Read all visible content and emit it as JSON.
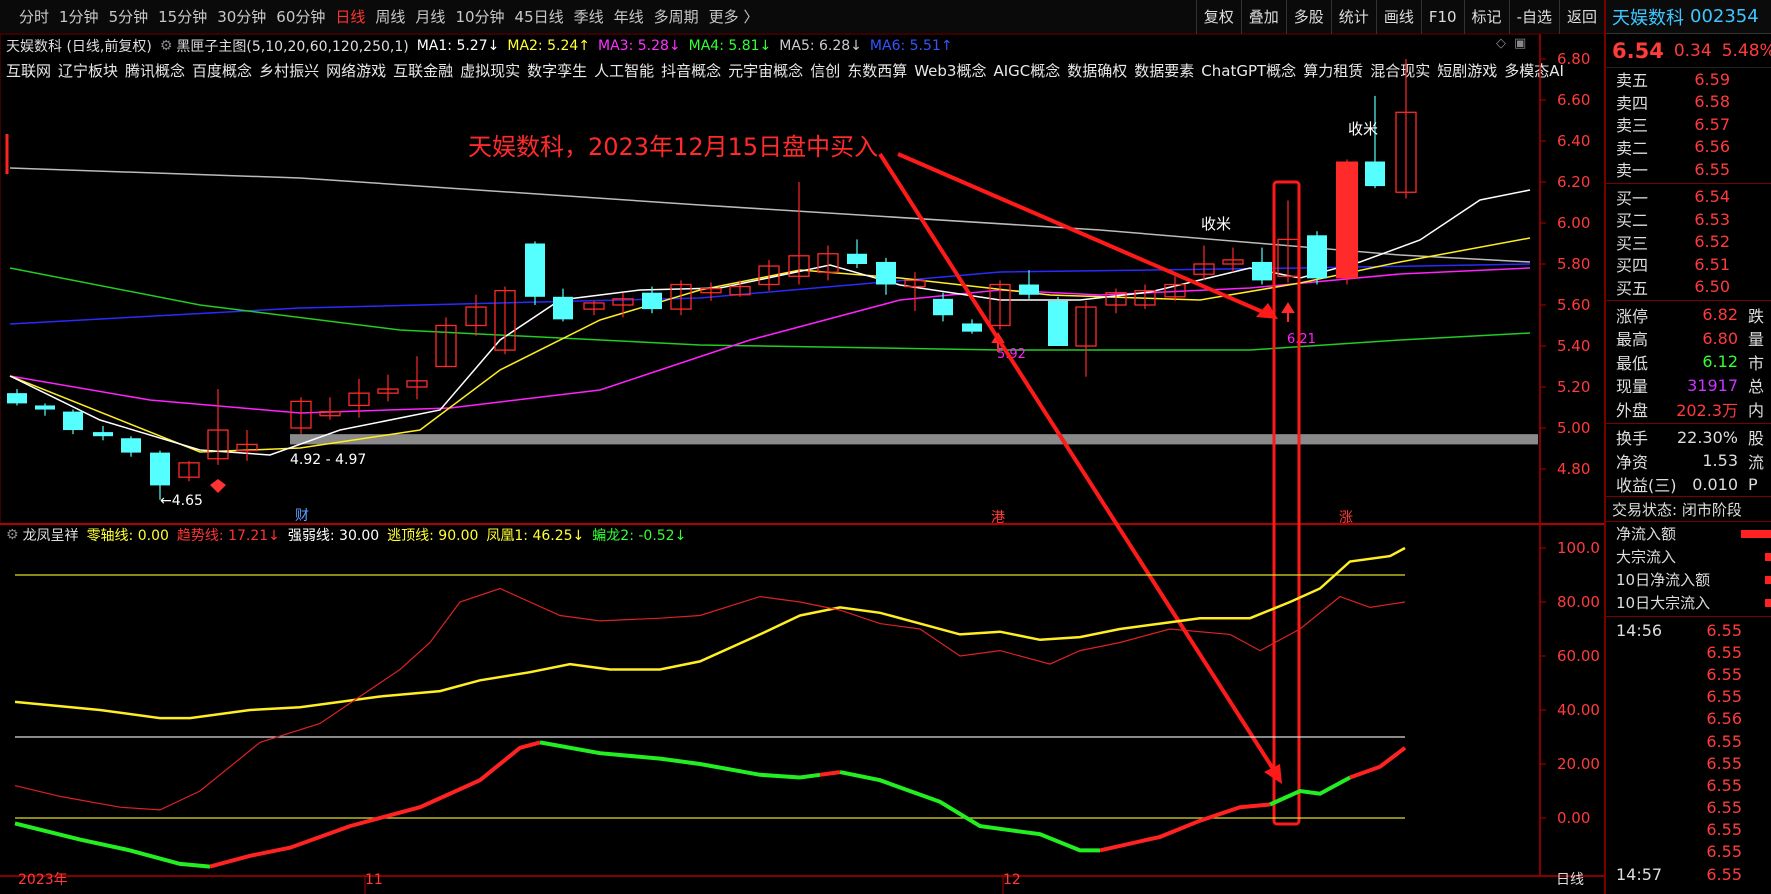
{
  "toolbar": {
    "periods": [
      "分时",
      "1分钟",
      "5分钟",
      "15分钟",
      "30分钟",
      "60分钟",
      "日线",
      "周线",
      "月线",
      "10分钟",
      "45日线",
      "季线",
      "年线",
      "多周期",
      "更多 〉"
    ],
    "active_period": "日线",
    "right_tools": [
      "复权",
      "叠加",
      "多股",
      "统计",
      "画线",
      "F10",
      "标记",
      "-自选",
      "返回"
    ]
  },
  "info": {
    "stock_title": "天娱数科 (日线,前复权)",
    "indicator_name": "黑匣子主图(5,10,20,60,120,250,1)",
    "ma1": "MA1: 5.27↓",
    "ma2": "MA2: 5.24↑",
    "ma3": "MA3: 5.28↓",
    "ma4": "MA4: 5.81↓",
    "ma5": "MA5: 6.28↓",
    "ma6": "MA6: 5.51↑",
    "colors": {
      "ma1": "#ffffff",
      "ma2": "#ffff33",
      "ma3": "#ff33ff",
      "ma4": "#33ff33",
      "ma5": "#cccccc",
      "ma6": "#3333ff"
    }
  },
  "concepts": [
    "互联网",
    "辽宁板块",
    "腾讯概念",
    "百度概念",
    "乡村振兴",
    "网络游戏",
    "互联金融",
    "虚拟现实",
    "数字孪生",
    "人工智能",
    "抖音概念",
    "元宇宙概念",
    "信创",
    "东数西算",
    "Web3概念",
    "AIGC概念",
    "数据确权",
    "数据要素",
    "ChatGPT概念",
    "算力租赁",
    "混合现实",
    "短剧游戏",
    "多模态AI"
  ],
  "annotation": {
    "buy_text": "天娱数科，2023年12月15日盘中买入",
    "label_shoumi1": "收米",
    "label_shoumi2": "收米",
    "label_low": "←4.65",
    "label_support": "4.92 - 4.97",
    "label_592": "5.92",
    "label_621": "6.21",
    "marker_cai": "财",
    "marker_gang": "港",
    "marker_zhang": "涨"
  },
  "price_axis": [
    "6.80",
    "6.60",
    "6.40",
    "6.20",
    "6.00",
    "5.80",
    "5.60",
    "5.40",
    "5.20",
    "5.00",
    "4.80"
  ],
  "indicator": {
    "name": "龙凤呈祥",
    "zero": "零轴线: 0.00",
    "trend": "趋势线: 17.21↓",
    "strong": "强弱线: 30.00",
    "escape": "逃顶线: 90.00",
    "phoenix": "凤凰1: 46.25↓",
    "dragon": "蝙龙2: -0.52↓",
    "axis": [
      "100.0",
      "80.00",
      "60.00",
      "40.00",
      "20.00",
      "0.00"
    ]
  },
  "date_axis": {
    "d1": "2023年",
    "d2": "11",
    "d3": "12",
    "period": "日线"
  },
  "panel": {
    "name": "天娱数科",
    "code": "002354",
    "price": "6.54",
    "change": "0.34",
    "pct": "5.48%",
    "asks": [
      {
        "l": "卖五",
        "p": "6.59"
      },
      {
        "l": "卖四",
        "p": "6.58"
      },
      {
        "l": "卖三",
        "p": "6.57"
      },
      {
        "l": "卖二",
        "p": "6.56"
      },
      {
        "l": "卖一",
        "p": "6.55"
      }
    ],
    "bids": [
      {
        "l": "买一",
        "p": "6.54"
      },
      {
        "l": "买二",
        "p": "6.53"
      },
      {
        "l": "买三",
        "p": "6.52"
      },
      {
        "l": "买四",
        "p": "6.51"
      },
      {
        "l": "买五",
        "p": "6.50"
      }
    ],
    "stats": [
      {
        "l": "涨停",
        "v": "6.82",
        "c": "#ff3b3b",
        "x": "跌"
      },
      {
        "l": "最高",
        "v": "6.80",
        "c": "#ff3b3b",
        "x": "量"
      },
      {
        "l": "最低",
        "v": "6.12",
        "c": "#33ff33",
        "x": "市"
      },
      {
        "l": "现量",
        "v": "31917",
        "c": "#cc33ff",
        "x": "总"
      },
      {
        "l": "外盘",
        "v": "202.3万",
        "c": "#ff3b3b",
        "x": "内"
      }
    ],
    "stats2": [
      {
        "l": "换手",
        "v": "22.30%",
        "c": "#dddddd",
        "x": "股"
      },
      {
        "l": "净资",
        "v": "1.53",
        "c": "#dddddd",
        "x": "流"
      },
      {
        "l": "收益(三)",
        "v": "0.010",
        "c": "#dddddd",
        "x": "P"
      }
    ],
    "trade_state": "交易状态: 闭市阶段",
    "flows": [
      "净流入额",
      "大宗流入",
      "10日净流入额",
      "10日大宗流入"
    ],
    "ticks": [
      {
        "t": "14:56",
        "p": "6.55"
      },
      {
        "t": "",
        "p": "6.55"
      },
      {
        "t": "",
        "p": "6.55"
      },
      {
        "t": "",
        "p": "6.55"
      },
      {
        "t": "",
        "p": "6.56"
      },
      {
        "t": "",
        "p": "6.55"
      },
      {
        "t": "",
        "p": "6.55"
      },
      {
        "t": "",
        "p": "6.55"
      },
      {
        "t": "",
        "p": "6.55"
      },
      {
        "t": "",
        "p": "6.55"
      },
      {
        "t": "",
        "p": "6.55"
      },
      {
        "t": "14:57",
        "p": "6.55"
      }
    ]
  }
}
